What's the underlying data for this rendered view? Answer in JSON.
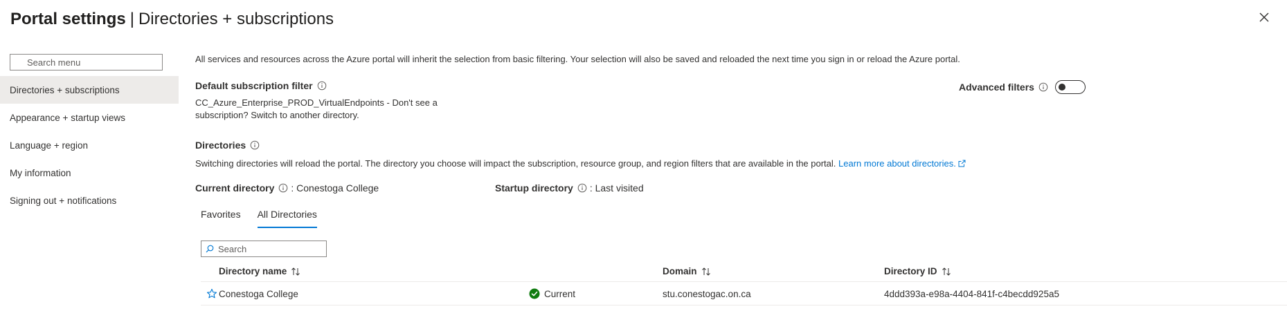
{
  "header": {
    "title": "Portal settings",
    "separator": "|",
    "subtitle": "Directories + subscriptions"
  },
  "sidebar": {
    "search_placeholder": "Search menu",
    "items": [
      {
        "label": "Directories + subscriptions",
        "active": true
      },
      {
        "label": "Appearance + startup views"
      },
      {
        "label": "Language + region"
      },
      {
        "label": "My information"
      },
      {
        "label": "Signing out + notifications"
      }
    ]
  },
  "main": {
    "intro": "All services and resources across the Azure portal will inherit the selection from basic filtering. Your selection will also be saved and reloaded the next time you sign in or reload the Azure portal.",
    "subscription_filter": {
      "title": "Default subscription filter",
      "text": "CC_Azure_Enterprise_PROD_VirtualEndpoints - Don't see a subscription? Switch to another directory."
    },
    "advanced_filters": {
      "label": "Advanced filters",
      "enabled": false
    },
    "directories": {
      "title": "Directories",
      "description": "Switching directories will reload the portal. The directory you choose will impact the subscription, resource group, and region filters that are available in the portal.",
      "learn_more": "Learn more about directories.",
      "current_label": "Current directory",
      "current_value": ": Conestoga College",
      "startup_label": "Startup directory",
      "startup_value": ": Last visited"
    },
    "tabs": [
      {
        "label": "Favorites",
        "active": false
      },
      {
        "label": "All Directories",
        "active": true
      }
    ],
    "search_placeholder": "Search",
    "table": {
      "columns": [
        "Directory name",
        "Domain",
        "Directory ID"
      ],
      "rows": [
        {
          "name": "Conestoga College",
          "status": "Current",
          "domain": "stu.conestogac.on.ca",
          "id": "4ddd393a-e98a-4404-841f-c4becdd925a5"
        }
      ]
    }
  },
  "colors": {
    "accent": "#0078d4",
    "success": "#107c10",
    "active_nav_bg": "#edebe9"
  }
}
